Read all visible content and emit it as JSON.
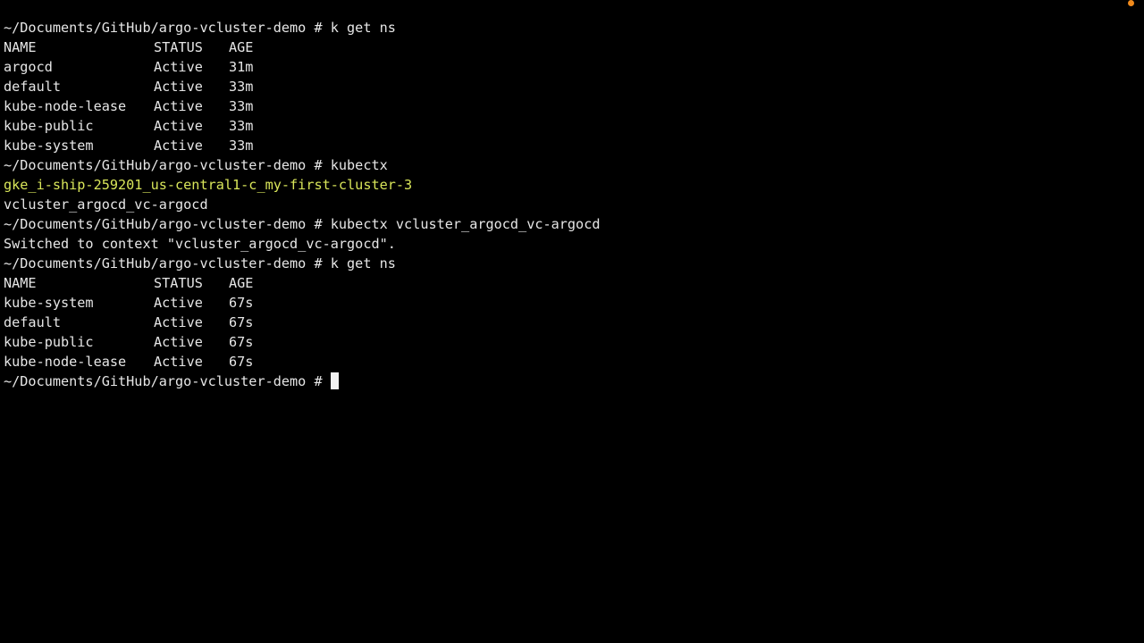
{
  "colors": {
    "background": "#000000",
    "text": "#e6e6e6",
    "current_context": "#d9e65a",
    "indicator": "#f08a1c"
  },
  "icons": {
    "indicator": "orange-dot-icon",
    "cursor": "block-cursor-icon"
  },
  "terminal": {
    "prompt": "~/Documents/GitHub/argo-vcluster-demo # ",
    "cmd1": "k get ns",
    "table1": {
      "headers": [
        "NAME",
        "STATUS",
        "AGE"
      ],
      "rows": [
        [
          "argocd",
          "Active",
          "31m"
        ],
        [
          "default",
          "Active",
          "33m"
        ],
        [
          "kube-node-lease",
          "Active",
          "33m"
        ],
        [
          "kube-public",
          "Active",
          "33m"
        ],
        [
          "kube-system",
          "Active",
          "33m"
        ]
      ]
    },
    "cmd2": "kubectx",
    "contexts": [
      "gke_i-ship-259201_us-central1-c_my-first-cluster-3",
      "vcluster_argocd_vc-argocd"
    ],
    "cmd3": "kubectx vcluster_argocd_vc-argocd",
    "switch_msg": "Switched to context \"vcluster_argocd_vc-argocd\".",
    "cmd4": "k get ns",
    "table2": {
      "headers": [
        "NAME",
        "STATUS",
        "AGE"
      ],
      "rows": [
        [
          "kube-system",
          "Active",
          "67s"
        ],
        [
          "default",
          "Active",
          "67s"
        ],
        [
          "kube-public",
          "Active",
          "67s"
        ],
        [
          "kube-node-lease",
          "Active",
          "67s"
        ]
      ]
    }
  }
}
